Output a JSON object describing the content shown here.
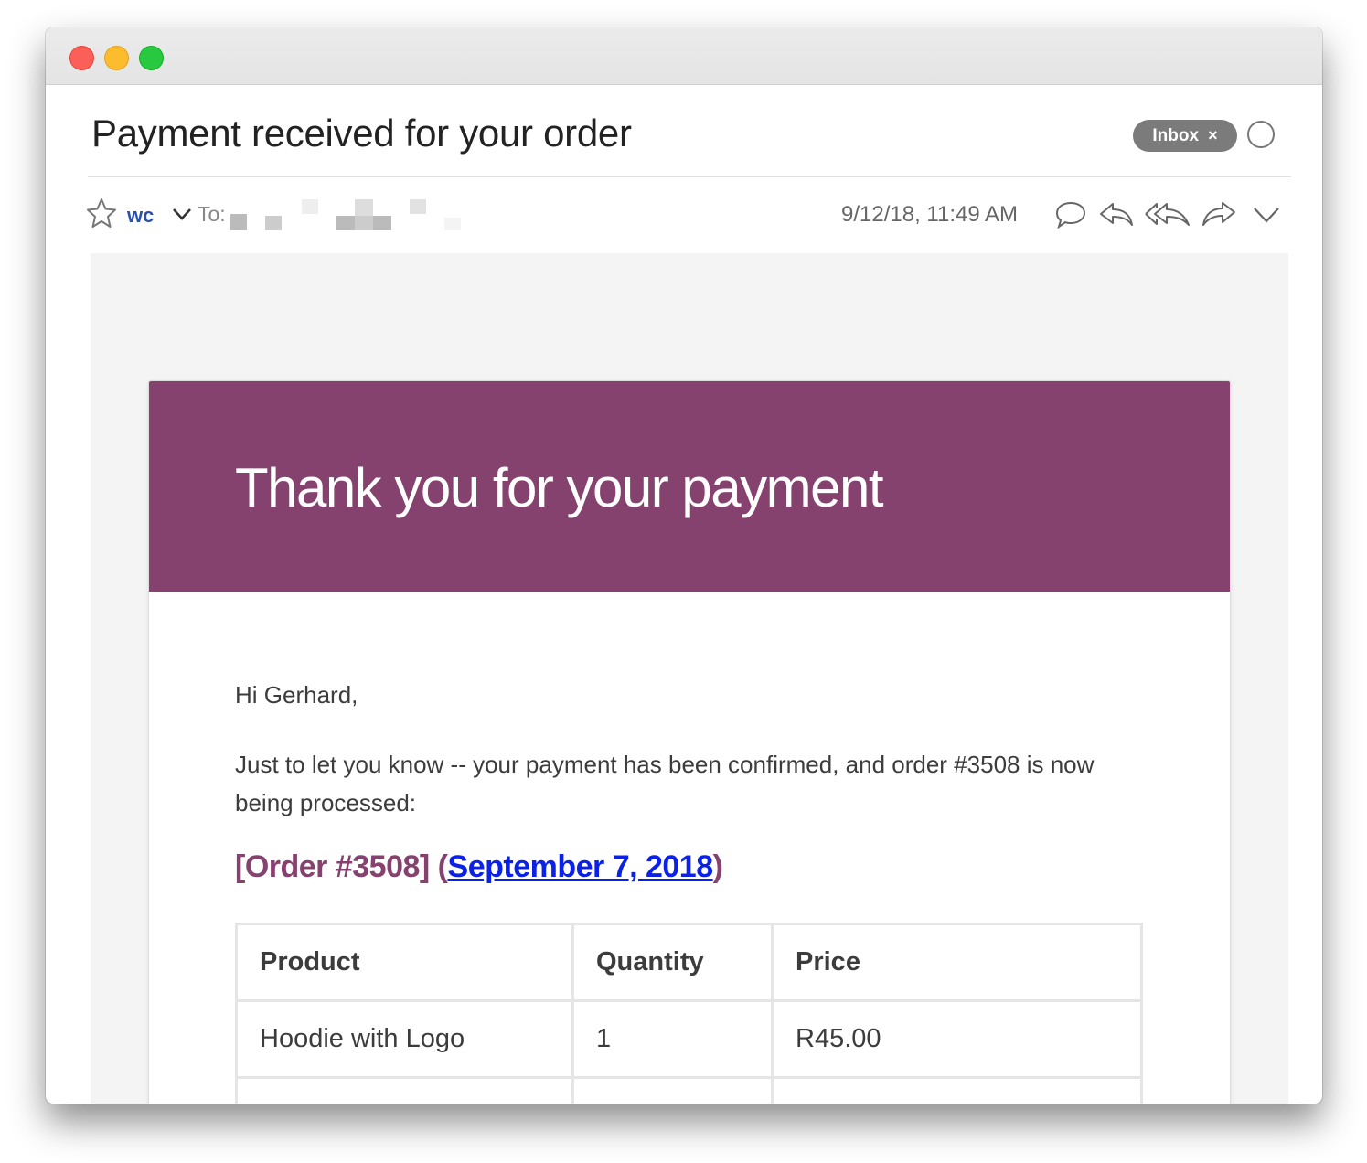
{
  "window": {
    "title_controls": [
      "close",
      "minimize",
      "maximize"
    ]
  },
  "message": {
    "subject": "Payment received for your order",
    "label_badge": "Inbox",
    "label_remove": "×",
    "sender": "wc",
    "to_label": "To:",
    "datetime": "9/12/18, 11:49 AM",
    "actions": [
      "speech-bubble-icon",
      "reply-icon",
      "reply-all-icon",
      "forward-icon",
      "more-chevron-icon"
    ]
  },
  "email": {
    "accent_color": "#85426f",
    "heading": "Thank you for your payment",
    "greeting": "Hi Gerhard,",
    "intro": "Just to let you know -- your payment has been confirmed, and order #3508 is now being processed:",
    "order_label": "[Order #3508]",
    "order_paren_open": " (",
    "order_date": "September 7, 2018",
    "order_paren_close": ")",
    "table": {
      "headers": [
        "Product",
        "Quantity",
        "Price"
      ],
      "rows": [
        [
          "Hoodie with Logo",
          "1",
          "R45.00"
        ]
      ]
    }
  }
}
